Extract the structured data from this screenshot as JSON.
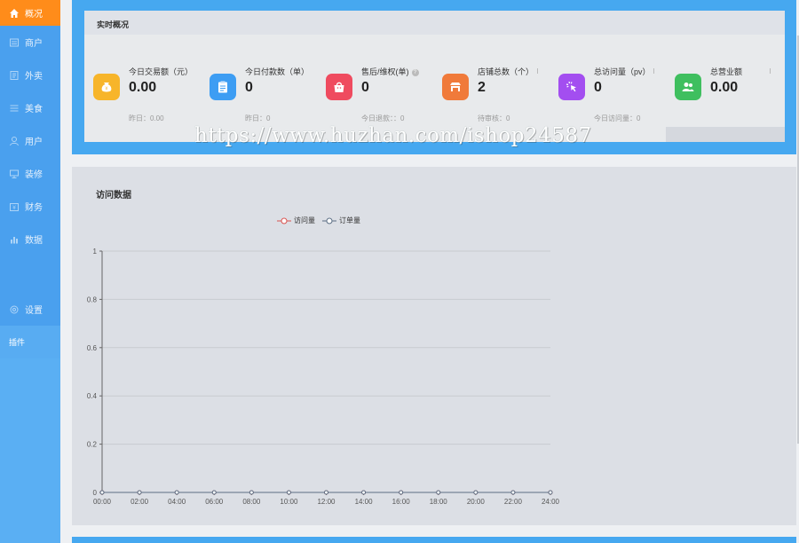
{
  "sidebar": {
    "items": [
      {
        "label": "概况",
        "icon": "home-icon"
      },
      {
        "label": "商户",
        "icon": "store-icon"
      },
      {
        "label": "外卖",
        "icon": "takeout-icon"
      },
      {
        "label": "美食",
        "icon": "food-icon"
      },
      {
        "label": "用户",
        "icon": "user-icon"
      },
      {
        "label": "装修",
        "icon": "decorate-icon"
      },
      {
        "label": "财务",
        "icon": "finance-icon"
      },
      {
        "label": "数据",
        "icon": "chart-icon"
      }
    ],
    "settings_label": "设置",
    "plugin_label": "插件"
  },
  "overview": {
    "title": "实时概况",
    "stats": [
      {
        "label": "今日交易额（元）",
        "value": "0.00",
        "sub": "昨日：0.00",
        "color": "#f7b52a",
        "icon": "money-bag-icon"
      },
      {
        "label": "今日付款数（单）",
        "value": "0",
        "sub": "昨日：0",
        "color": "#3d9df3",
        "icon": "clipboard-icon"
      },
      {
        "label": "售后/维权(单)",
        "value": "0",
        "sub": "今日退款：：0",
        "color": "#ef4b5f",
        "icon": "shopping-bag-icon",
        "help": "?"
      },
      {
        "label": "店铺总数（个）",
        "value": "2",
        "sub": "待审核：0",
        "color": "#f07a3a",
        "icon": "shop-icon"
      },
      {
        "label": "总访问量（pv）",
        "value": "0",
        "sub": "今日访问量：0",
        "color": "#a34ef0",
        "icon": "click-icon"
      },
      {
        "label": "总营业额",
        "value": "0.00",
        "sub": "",
        "color": "#3fbf5f",
        "icon": "users-icon"
      }
    ]
  },
  "watermark": "https://www.huzhan.com/ishop24587",
  "visit": {
    "title": "访问数据",
    "legend": [
      "访问量",
      "订单量"
    ]
  },
  "chart_data": {
    "type": "line",
    "categories": [
      "00:00",
      "02:00",
      "04:00",
      "06:00",
      "08:00",
      "10:00",
      "12:00",
      "14:00",
      "16:00",
      "18:00",
      "20:00",
      "22:00",
      "24:00"
    ],
    "series": [
      {
        "name": "访问量",
        "values": [
          0,
          0,
          0,
          0,
          0,
          0,
          0,
          0,
          0,
          0,
          0,
          0,
          0
        ],
        "color": "#d9534f"
      },
      {
        "name": "订单量",
        "values": [
          0,
          0,
          0,
          0,
          0,
          0,
          0,
          0,
          0,
          0,
          0,
          0,
          0
        ],
        "color": "#5b6e84"
      }
    ],
    "yticks": [
      "0",
      "0.2",
      "0.4",
      "0.6",
      "0.8",
      "1"
    ],
    "ylim": [
      0,
      1
    ],
    "grid": true,
    "legend_position": "top"
  }
}
